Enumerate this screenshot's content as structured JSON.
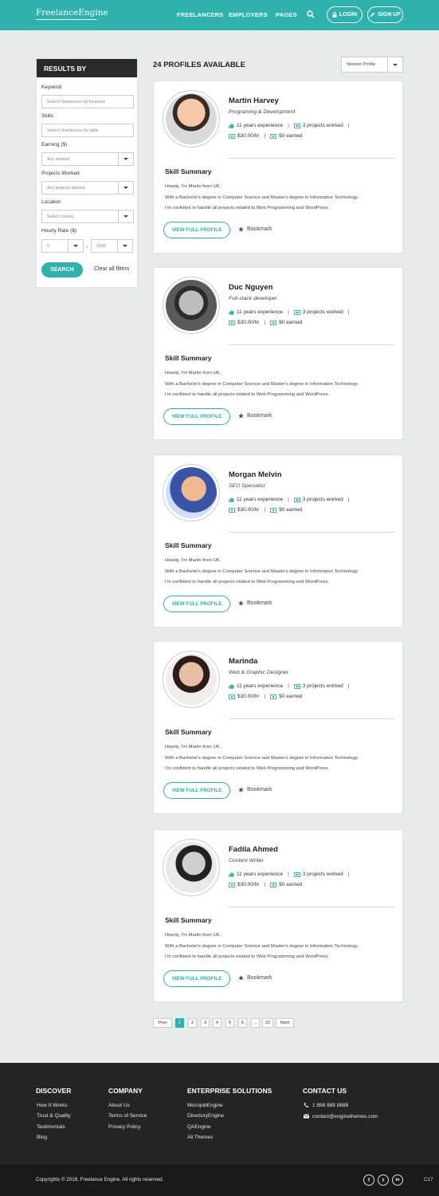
{
  "header": {
    "logo": "FreelanceEngine",
    "nav": [
      "FREELANCERS",
      "EMPLOYERS",
      "PAGES"
    ],
    "login": "LOGIN",
    "signup": "SIGN UP"
  },
  "sidebar": {
    "title": "RESULTS BY",
    "keyword_label": "Keyword",
    "keyword_placeholder": "Search freelancers by keyword",
    "skills_label": "Skills",
    "skills_placeholder": "Search freelancers by skills",
    "earning_label": "Earning ($)",
    "earning_value": "Any amount",
    "projects_label": "Projects Worked",
    "projects_value": "Any projects worked",
    "location_label": "Location",
    "location_value": "Select country",
    "rate_label": "Hourly Rate ($)",
    "rate_min": "0",
    "rate_sep": "-",
    "rate_max": "2500",
    "search_btn": "SEARCH",
    "clear": "Clear all filters"
  },
  "list": {
    "count": "24 PROFILES AVAILABLE",
    "sort": "Newest Profile"
  },
  "profiles": [
    {
      "name": "Martin Harvey",
      "role": "Programing & Development",
      "experience": "11 years experience",
      "projects": "3 projects worked",
      "rate": "$30.00/hr",
      "earned": "$0 earned"
    },
    {
      "name": "Duc Nguyen",
      "role": "Full-stack developer",
      "experience": "11 years experience",
      "projects": "3 projects worked",
      "rate": "$30.00/hr",
      "earned": "$0 earned"
    },
    {
      "name": "Morgan Melvin",
      "role": "SEO Specialist",
      "experience": "11 years experience",
      "projects": "3 projects worked",
      "rate": "$30.00/hr",
      "earned": "$0 earned"
    },
    {
      "name": "Marinda",
      "role": "Web & Graphic Designer",
      "experience": "11 years experience",
      "projects": "3 projects worked",
      "rate": "$30.00/hr",
      "earned": "$0 earned"
    },
    {
      "name": "Fadila Ahmed",
      "role": "Content Writer",
      "experience": "11 years experience",
      "projects": "3 projects worked",
      "rate": "$30.00/hr",
      "earned": "$0 earned"
    }
  ],
  "card_common": {
    "skill_title": "Skill Summary",
    "bio": [
      "Howdy, I'm Martin from UK.",
      "With a Bachelor's degree in Computer Science and Master's degree in Information Technology.",
      "I'm confident to handle all projects related to Web Programming and WordPress."
    ],
    "view_btn": "VIEW FULL PROFILE",
    "bookmark": "Bookmark"
  },
  "pagination": [
    "Prev",
    "1",
    "2",
    "3",
    "4",
    "5",
    "6",
    "...",
    "22",
    "Next"
  ],
  "pagination_active": "1",
  "footer": {
    "discover": {
      "title": "DISCOVER",
      "links": [
        "How It Works",
        "Trust & Quality",
        "Testimonials",
        "Blog"
      ]
    },
    "company": {
      "title": "COMPANY",
      "links": [
        "About Us",
        "Terms of Service",
        "Privacy Policy"
      ]
    },
    "enterprise": {
      "title": "ENTERPRISE SOLUTIONS",
      "links": [
        "MicrojobEngine",
        "DirectoryEngine",
        "QAEngine",
        "All Themes"
      ]
    },
    "contact": {
      "title": "CONTACT US",
      "phone": "1 888 888 8888",
      "email": "contact@enginethemes.com"
    },
    "copyright": "Copyrights © 2018, Freelance Engine. All rights reserved.",
    "social": [
      "f",
      "t",
      "in"
    ],
    "badge": "C17"
  },
  "colors": {
    "accent": "#2fb1ac",
    "footer": "#242424"
  }
}
